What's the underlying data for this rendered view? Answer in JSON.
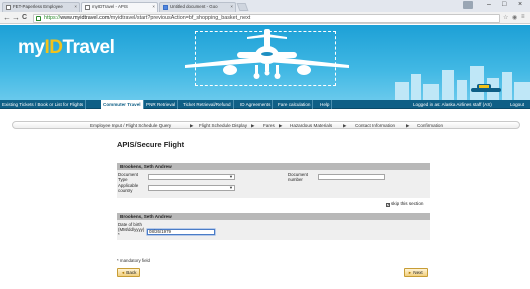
{
  "browser": {
    "tabs": [
      {
        "label": "FET-Paperless Employee",
        "active": false
      },
      {
        "label": "myIDTravel - APIS",
        "active": true
      },
      {
        "label": "Untitled document - Goo",
        "active": false
      }
    ],
    "close_glyph": "×",
    "window_controls": {
      "minimize": "–",
      "maximize": "□",
      "close": "×"
    },
    "nav": {
      "back": "←",
      "forward": "→",
      "reload": "C"
    },
    "address": {
      "scheme": "https://",
      "host": "www.myidtravel.com",
      "path": "/myidtravel/start?previousAction=bf_shopping_basket_next"
    }
  },
  "site": {
    "logo": {
      "my": "my",
      "id": "ID",
      "travel": "Travel"
    },
    "accent_blue": "#1da0d6",
    "accent_yellow": "#f3c21a",
    "nav_items": [
      {
        "label": "Existing Tickets / Book or List for Flights",
        "active": false
      },
      {
        "label": "Commuter Travel",
        "active": true
      },
      {
        "label": "PNR Retrieval",
        "active": false
      },
      {
        "label": "Ticket Retrieval/Refund",
        "active": false
      },
      {
        "label": "ID Agreements",
        "active": false
      },
      {
        "label": "Fare calculation",
        "active": false
      },
      {
        "label": "Help",
        "active": false
      }
    ],
    "logged_in": "Logged in as: Alaska Airlines staff (AS)",
    "logout": "Logout"
  },
  "steps": [
    "Employee Input / Flight Schedule Query",
    "Flight Schedule Display",
    "Fares",
    "Hazardous Materials",
    "Contact Information",
    "Confirmation"
  ],
  "step_separator": "▶",
  "form": {
    "title": "APIS/Secure Flight",
    "section1": {
      "header": "Brookens, Seth Andrew",
      "document_type_label": "Document Type",
      "document_number_label": "Document number",
      "applicable_country_label": "Applicable country",
      "skip_label": "skip this section",
      "skip_checked": true
    },
    "section2": {
      "header": "Brookens, Seth Andrew",
      "dob_label": "Date of birth (MM/dd/yyyy)",
      "dob_value": "08/26/1979",
      "asterisk": "*"
    },
    "mandatory_note": "* mandatory field",
    "back_label": "Back",
    "next_label": "Next",
    "back_glyph": "◄",
    "next_glyph": "►"
  }
}
